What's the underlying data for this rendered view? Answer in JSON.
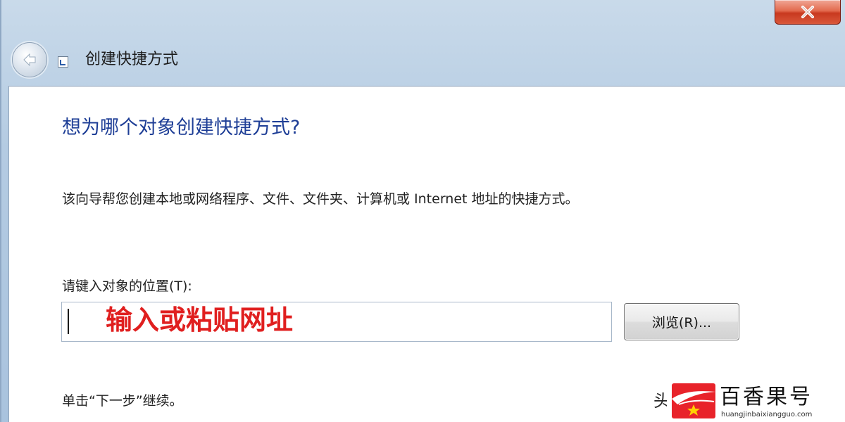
{
  "window": {
    "title": "创建快捷方式",
    "close_symbol": "✕",
    "back_icon": "back-arrow-icon"
  },
  "content": {
    "heading": "想为哪个对象创建快捷方式?",
    "description": "该向导帮您创建本地或网络程序、文件、文件夹、计算机或 Internet 地址的快捷方式。",
    "location_label": "请键入对象的位置(T):",
    "location_value": "",
    "overlay_annotation": "输入或粘贴网址",
    "browse_label": "浏览(R)...",
    "footer_hint": "单击“下一步”继续。",
    "cut_off_char": "头"
  },
  "watermark": {
    "text": "百香果号",
    "url": "huangjinbaixiangguo.com"
  },
  "colors": {
    "heading": "#1e3e96",
    "overlay": "#e01f1f",
    "close_button": "#c8391f",
    "watermark_logo": "#e8232a"
  }
}
